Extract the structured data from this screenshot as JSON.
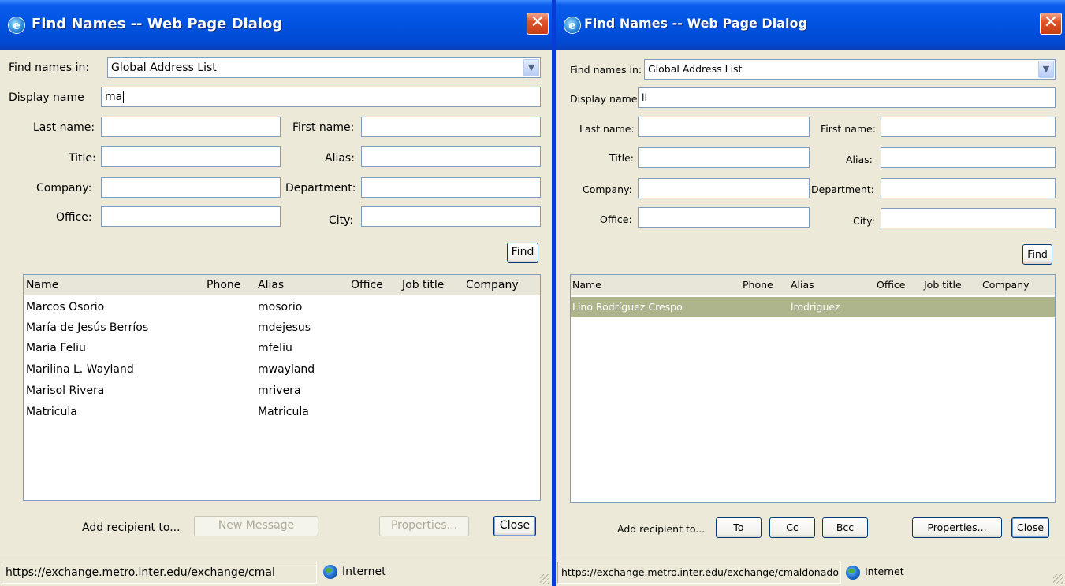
{
  "left": {
    "title": "Find Names -- Web Page Dialog",
    "find_names_in": {
      "label": "Find names in:",
      "value": "Global Address List"
    },
    "display_name": {
      "label": "Display name",
      "value": "ma"
    },
    "fields": {
      "last_name": {
        "label": "Last name:",
        "value": ""
      },
      "first_name": {
        "label": "First name:",
        "value": ""
      },
      "title": {
        "label": "Title:",
        "value": ""
      },
      "alias": {
        "label": "Alias:",
        "value": ""
      },
      "company": {
        "label": "Company:",
        "value": ""
      },
      "department": {
        "label": "Department:",
        "value": ""
      },
      "office": {
        "label": "Office:",
        "value": ""
      },
      "city": {
        "label": "City:",
        "value": ""
      }
    },
    "find_button": "Find",
    "columns": {
      "name": "Name",
      "phone": "Phone",
      "alias": "Alias",
      "office": "Office",
      "job_title": "Job title",
      "company": "Company"
    },
    "rows": [
      {
        "name": "Marcos Osorio",
        "alias": "mosorio"
      },
      {
        "name": "María de Jesús Berríos",
        "alias": "mdejesus"
      },
      {
        "name": "Maria Feliu",
        "alias": "mfeliu"
      },
      {
        "name": "Marilina L. Wayland",
        "alias": "mwayland"
      },
      {
        "name": "Marisol Rivera",
        "alias": "mrivera"
      },
      {
        "name": "Matricula",
        "alias": "Matricula"
      }
    ],
    "add_recipient_label": "Add recipient to...",
    "new_message_button": "New Message",
    "properties_button": "Properties...",
    "close_button": "Close",
    "status_url": "https://exchange.metro.inter.edu/exchange/cmal",
    "status_zone": "Internet"
  },
  "right": {
    "title": "Find Names -- Web Page Dialog",
    "find_names_in": {
      "label": "Find names in:",
      "value": "Global Address List"
    },
    "display_name": {
      "label": "Display name",
      "value": "li"
    },
    "fields": {
      "last_name": {
        "label": "Last name:",
        "value": ""
      },
      "first_name": {
        "label": "First name:",
        "value": ""
      },
      "title": {
        "label": "Title:",
        "value": ""
      },
      "alias": {
        "label": "Alias:",
        "value": ""
      },
      "company": {
        "label": "Company:",
        "value": ""
      },
      "department": {
        "label": "Department:",
        "value": ""
      },
      "office": {
        "label": "Office:",
        "value": ""
      },
      "city": {
        "label": "City:",
        "value": ""
      }
    },
    "find_button": "Find",
    "columns": {
      "name": "Name",
      "phone": "Phone",
      "alias": "Alias",
      "office": "Office",
      "job_title": "Job title",
      "company": "Company"
    },
    "rows": [
      {
        "name": "Lino Rodríguez Crespo",
        "alias": "lrodriguez",
        "selected": true
      }
    ],
    "add_recipient_label": "Add recipient to...",
    "to_button": "To",
    "cc_button": "Cc",
    "bcc_button": "Bcc",
    "properties_button": "Properties...",
    "close_button": "Close",
    "status_url": "https://exchange.metro.inter.edu/exchange/cmaldonado",
    "status_zone": "Internet"
  },
  "colors": {
    "titlebar": "#0154e1",
    "dialog_bg": "#ece9d8",
    "selected_row": "#aeb48c",
    "input_border": "#7f9db9"
  }
}
